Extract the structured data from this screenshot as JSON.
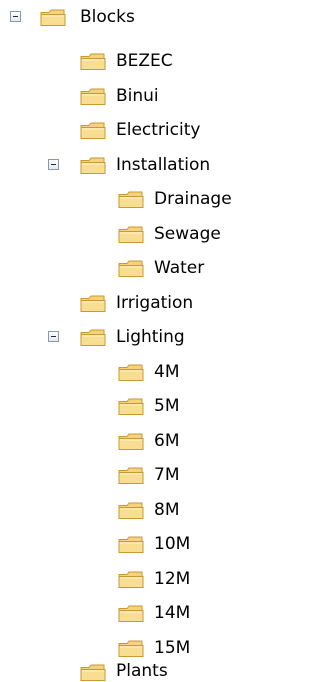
{
  "tree": {
    "root": "Blocks",
    "blocks_children": [
      "BEZEC",
      "Binui",
      "Electricity"
    ],
    "installation": "Installation",
    "installation_children": [
      "Drainage",
      "Sewage",
      "Water"
    ],
    "irrigation": "Irrigation",
    "lighting": "Lighting",
    "lighting_children": [
      "4M",
      "5M",
      "6M",
      "7M",
      "8M",
      "10M",
      "12M",
      "14M",
      "15M"
    ],
    "plants": "Plants"
  },
  "icons": {
    "expanded": "minus-box-icon",
    "folder": "folder-icon"
  },
  "colors": {
    "folder_fill": "#f6d27a",
    "folder_edge": "#c79a36",
    "expander_border": "#8a98ad"
  }
}
